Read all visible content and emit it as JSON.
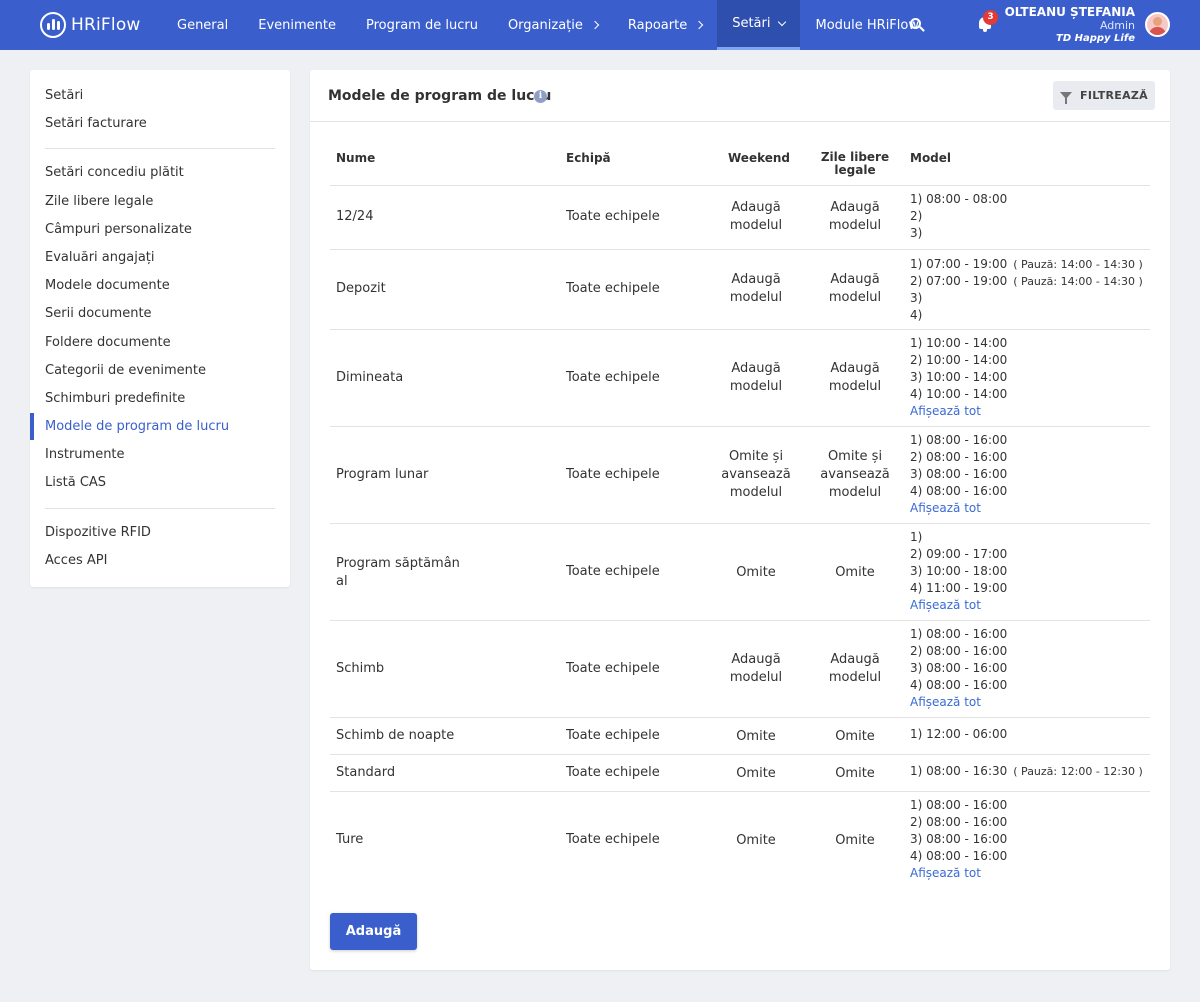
{
  "app": {
    "name": "HRiFlow"
  },
  "nav": {
    "items": [
      {
        "label": "General"
      },
      {
        "label": "Evenimente"
      },
      {
        "label": "Program de lucru"
      },
      {
        "label": "Organizație"
      },
      {
        "label": "Rapoarte"
      },
      {
        "label": "Setări"
      },
      {
        "label": "Module HRiFlow"
      }
    ],
    "notification_count": "3"
  },
  "user": {
    "name": "OLTEANU ȘTEFANIA",
    "role": "Admin",
    "company": "TD Happy Life"
  },
  "sidebar": {
    "items": [
      {
        "label": "Setări"
      },
      {
        "label": "Setări facturare"
      },
      {
        "label": "Setări concediu plătit"
      },
      {
        "label": "Zile libere legale"
      },
      {
        "label": "Câmpuri personalizate"
      },
      {
        "label": "Evaluări angajați"
      },
      {
        "label": "Modele documente"
      },
      {
        "label": "Serii documente"
      },
      {
        "label": "Foldere documente"
      },
      {
        "label": "Categorii de evenimente"
      },
      {
        "label": "Schimburi predefinite"
      },
      {
        "label": "Modele de program de lucru"
      },
      {
        "label": "Instrumente"
      },
      {
        "label": "Listă CAS"
      },
      {
        "label": "Dispozitive RFID"
      },
      {
        "label": "Acces API"
      }
    ]
  },
  "main": {
    "title": "Modele de program de lucru",
    "filter_label": "FILTREAZĂ",
    "add_label": "Adaugă",
    "show_all_label": "Afișează tot",
    "columns": {
      "name": "Nume",
      "team": "Echipă",
      "weekend": "Weekend",
      "holidays_1": "Zile libere",
      "holidays_2": "legale",
      "model": "Model"
    },
    "rows": [
      {
        "name": "12/24",
        "team": "Toate echipele",
        "weekend": [
          "Adaugă",
          "modelul"
        ],
        "holidays": [
          "Adaugă",
          "modelul"
        ],
        "model": [
          "1) 08:00 - 08:00",
          "2)",
          "3)"
        ]
      },
      {
        "name": "Depozit",
        "team": "Toate echipele",
        "weekend": [
          "Adaugă",
          "modelul"
        ],
        "holidays": [
          "Adaugă",
          "modelul"
        ],
        "model": [
          "1) 07:00 - 19:00",
          "2) 07:00 - 19:00",
          "3)",
          "4)"
        ],
        "pauses": [
          "( Pauză: 14:00 - 14:30 )",
          "( Pauză: 14:00 - 14:30 )"
        ]
      },
      {
        "name": "Dimineata",
        "team": "Toate echipele",
        "weekend": [
          "Adaugă",
          "modelul"
        ],
        "holidays": [
          "Adaugă",
          "modelul"
        ],
        "model": [
          "1) 10:00 - 14:00",
          "2) 10:00 - 14:00",
          "3) 10:00 - 14:00",
          "4) 10:00 - 14:00"
        ]
      },
      {
        "name": "Program lunar",
        "team": "Toate echipele",
        "weekend": [
          "Omite și",
          "avansează",
          "modelul"
        ],
        "holidays": [
          "Omite și",
          "avansează",
          "modelul"
        ],
        "model": [
          "1) 08:00 - 16:00",
          "2) 08:00 - 16:00",
          "3) 08:00 - 16:00",
          "4) 08:00 - 16:00"
        ]
      },
      {
        "name": [
          "Program săptămân",
          "al"
        ],
        "team": "Toate echipele",
        "weekend": [
          "Omite"
        ],
        "holidays": [
          "Omite"
        ],
        "model": [
          "1)",
          "2) 09:00 - 17:00",
          "3) 10:00 - 18:00",
          "4) 11:00 - 19:00"
        ]
      },
      {
        "name": "Schimb",
        "team": "Toate echipele",
        "weekend": [
          "Adaugă",
          "modelul"
        ],
        "holidays": [
          "Adaugă",
          "modelul"
        ],
        "model": [
          "1) 08:00 - 16:00",
          "2) 08:00 - 16:00",
          "3) 08:00 - 16:00",
          "4) 08:00 - 16:00"
        ]
      },
      {
        "name": "Schimb de noapte",
        "team": "Toate echipele",
        "weekend": [
          "Omite"
        ],
        "holidays": [
          "Omite"
        ],
        "model": [
          "1) 12:00 - 06:00"
        ]
      },
      {
        "name": "Standard",
        "team": "Toate echipele",
        "weekend": [
          "Omite"
        ],
        "holidays": [
          "Omite"
        ],
        "model": [
          "1) 08:00 - 16:30"
        ],
        "pauses": [
          "( Pauză: 12:00 - 12:30 )"
        ]
      },
      {
        "name": "Ture",
        "team": "Toate echipele",
        "weekend": [
          "Omite"
        ],
        "holidays": [
          "Omite"
        ],
        "model": [
          "1) 08:00 - 16:00",
          "2) 08:00 - 16:00",
          "3) 08:00 - 16:00",
          "4) 08:00 - 16:00"
        ]
      }
    ]
  }
}
